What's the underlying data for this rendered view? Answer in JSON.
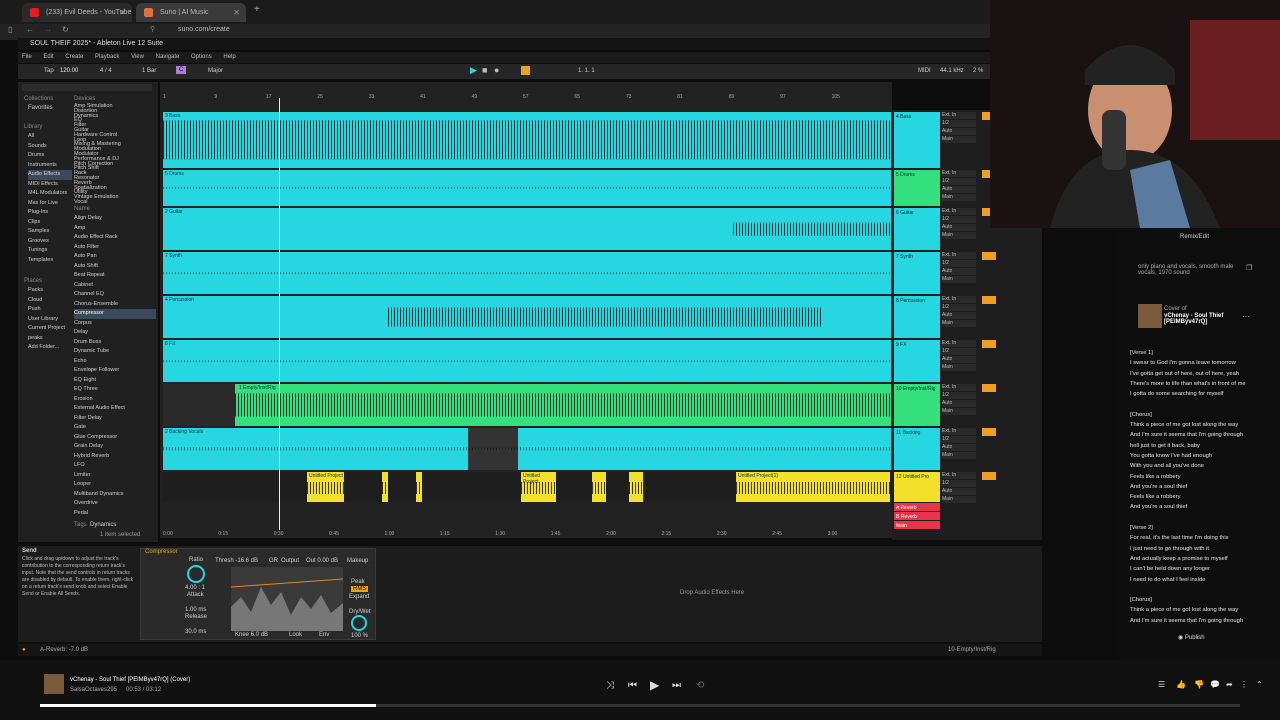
{
  "browser": {
    "tabs": [
      {
        "label": "(233) Evil Deeds - YouTube",
        "fav_color": "#e02020"
      },
      {
        "label": "Suno | AI Music",
        "fav_color": "#e07040"
      }
    ],
    "url": "suno.com/create"
  },
  "ableton": {
    "title": "SOUL THEIF 2025* - Ableton Live 12 Suite",
    "menu": [
      "File",
      "Edit",
      "Create",
      "Playback",
      "View",
      "Navigate",
      "Options",
      "Help"
    ],
    "control": {
      "tempo": "120.00",
      "sig": "4 / 4",
      "bars": "1 Bar",
      "key": "C",
      "scale": "Major",
      "pos": "1. 1. 1",
      "midi": "MIDI",
      "rate": "44.1 kHz",
      "cpu": "2 %"
    },
    "sidebar": {
      "collections_label": "Collections",
      "collections": [
        "Favorites"
      ],
      "library_label": "Library",
      "library": [
        "All",
        "Sounds",
        "Drums",
        "Instruments",
        "Audio Effects",
        "MIDI Effects",
        "M4L Modulators",
        "Max for Live",
        "Plug-Ins",
        "Clips",
        "Samples",
        "Grooves",
        "Tunings",
        "Templates"
      ],
      "places_label": "Places",
      "places": [
        "Packs",
        "Cloud",
        "Push",
        "User Library",
        "Current Project",
        "peaks",
        "Add Folder..."
      ],
      "device_categories": [
        "Amp Simulation",
        "Distortion",
        "Dynamics",
        "EQ",
        "Filter",
        "Guitar",
        "Hardware Control",
        "Loop",
        "Mixing & Mastering",
        "Modulation",
        "Modulator",
        "Performance & DJ",
        "Pitch Correction",
        "Pitch Shift",
        "Rack",
        "Resonator",
        "Reverb",
        "Spatialization",
        "Utility",
        "Vintage Emulation",
        "Vocal"
      ],
      "devices_label": "Devices",
      "name_label": "Name",
      "devices": [
        "Align Delay",
        "Amp",
        "Audio Effect Rack",
        "Auto Filter",
        "Auto Pan",
        "Auto Shift",
        "Beat Repeat",
        "Cabinet",
        "Channel EQ",
        "Chorus-Ensemble",
        "Compressor",
        "Corpus",
        "Delay",
        "Drum Buss",
        "Dynamic Tube",
        "Echo",
        "Envelope Follower",
        "EQ Eight",
        "EQ Three",
        "Erosion",
        "External Audio Effect",
        "Filter Delay",
        "Gate",
        "Glue Compressor",
        "Grain Delay",
        "Hybrid Reverb",
        "LFO",
        "Limiter",
        "Looper",
        "Multiband Dynamics",
        "Overdrive",
        "Pedal"
      ],
      "selected_device": "Compressor",
      "tags_label": "Tags",
      "tag": "Dynamics",
      "selection_info": "1 item selected"
    },
    "ruler": [
      "1",
      "9",
      "17",
      "25",
      "33",
      "41",
      "49",
      "57",
      "65",
      "73",
      "81",
      "89",
      "97",
      "105"
    ],
    "timeline": [
      "0:00",
      "0:15",
      "0:30",
      "0:45",
      "1:00",
      "1:15",
      "1:30",
      "1:45",
      "2:00",
      "2:15",
      "2:30",
      "2:45",
      "3:00"
    ],
    "tracks": [
      {
        "name": "4 Bass",
        "lane": "3 Bass",
        "color": "cyan"
      },
      {
        "name": "5 Drums",
        "lane": "5 Drums",
        "color": "cyan"
      },
      {
        "name": "6 Guitar",
        "lane": "2 Guitar",
        "color": "cyan"
      },
      {
        "name": "7 Synth",
        "lane": "7 Synth",
        "color": "cyan"
      },
      {
        "name": "8 Percussion",
        "lane": "4 Percussion",
        "color": "cyan"
      },
      {
        "name": "9 FX",
        "lane": "8 FX",
        "color": "cyan"
      },
      {
        "name": "10 Empty/Inst/Rig",
        "lane": "1 Empty/Inst/Rig",
        "color": "green"
      },
      {
        "name": "11 Backing",
        "lane": "2 Backing Vocals",
        "color": "cyan"
      },
      {
        "name": "12 Untitled Pro",
        "lane": "Untitled Project",
        "color": "yellow"
      },
      {
        "name": "A Reverb",
        "color": "red"
      },
      {
        "name": "B Reverb",
        "color": "red"
      },
      {
        "name": "Main",
        "color": "red"
      }
    ],
    "io": {
      "ext_in": "Ext. In",
      "auto": "Auto",
      "main": "Main",
      "half": "1/2",
      "off": "Off"
    },
    "clip_labels": {
      "untitled": "Untitled Project",
      "untitled_1": "Untitled Project(1)"
    },
    "device_panel": {
      "help_title": "Send",
      "help_text": "Click and drag up/down to adjust the track's contribution to the corresponding return track's input. Note that the send controls in return tracks are disabled by default. To enable them, right-click on a return track's send knob and select Enable Send or Enable All Sends.",
      "device_name": "Compressor",
      "thresh": "Thresh -16.6 dB",
      "gr": "GR",
      "output": "Output",
      "out": "Out 0.00 dB",
      "makeup": "Makeup",
      "peak": "Peak",
      "rms": "RMS",
      "expand": "Expand",
      "drywet": "Dry/Wet",
      "drywet_val": "100 %",
      "ratio": "Ratio",
      "ratio_val": "4.00 : 1",
      "attack": "Attack",
      "attack_val": "1.00 ms",
      "release": "Release",
      "release_val": "30.0 ms",
      "knee": "Knee 6.0 dB",
      "look": "Look",
      "env": "Env",
      "drop_text": "Drop Audio Effects Here"
    },
    "statusbar_left": "A-Reverb: -7.0 dB",
    "statusbar_right": "10-Empty/Inst/Rig"
  },
  "suno": {
    "remix_label": "Remix/Edit",
    "prompt": "only piano and vocals, smooth male vocals, 1970 sound",
    "cover_of": "Cover of",
    "song_title": "vChenay - Soul Thief [PElMByv47rQ]",
    "lyrics": [
      "[Verse 1]",
      "I swear to God I'm gonna leave tomorrow",
      "I've gotta get out of here, out of here, yeah",
      "There's more to life than what's in front of me",
      "I gotta do some searching for myself",
      "",
      "[Chorus]",
      "Think a piece of me got lost along the way",
      "And I'm sure it seems that I'm going through",
      "hell just to get it back, baby",
      "You gotta know I've had enough",
      "With you and all you've done",
      "Feels like a robbery",
      "And you're a soul thief",
      "Feels like a robbery",
      "And you're a soul thief",
      "",
      "[Verse 2]",
      "For real, it's the last time I'm doing this",
      "I just need to go through with it",
      "And actually keep a promise to myself",
      "I can't be held down any longer",
      "I need to do what I feel inside",
      "",
      "[Chorus]",
      "Think a piece of me got lost along the way",
      "And I'm sure it seems that I'm going through"
    ],
    "publish_label": "Publish"
  },
  "player": {
    "title": "vChenay - Soul Thief [PElMByv47rQ] (Cover)",
    "artist": "SalsaOctaves295",
    "time": "00:53 / 03:12",
    "progress": 0.28
  }
}
